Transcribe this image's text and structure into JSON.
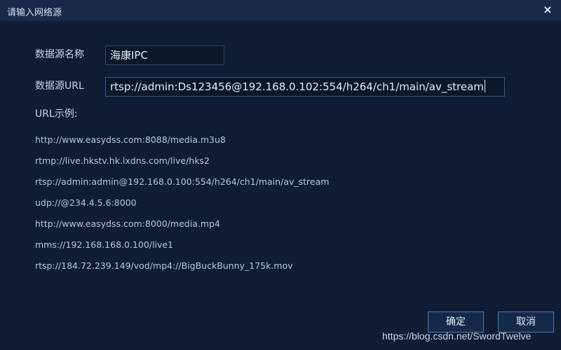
{
  "dialog": {
    "title": "请输入网络源",
    "close_label": "×"
  },
  "form": {
    "name_label": "数据源名称",
    "name_value": "海康IPC",
    "url_label": "数据源URL",
    "url_value": "rtsp://admin:Ds123456@192.168.0.102:554/h264/ch1/main/av_stream"
  },
  "examples": {
    "label": "URL示例:",
    "items": [
      "http://www.easydss.com:8088/media.m3u8",
      "rtmp://live.hkstv.hk.lxdns.com/live/hks2",
      "rtsp://admin:admin@192.168.0.100:554/h264/ch1/main/av_stream",
      "udp://@234.4.5.6:8000",
      "http://www.easydss.com:8000/media.mp4",
      "mms://192.168.168.0.100/live1",
      "rtsp://184.72.239.149/vod/mp4://BigBuckBunny_175k.mov"
    ]
  },
  "buttons": {
    "ok_label": "确定",
    "cancel_label": "取消"
  },
  "watermark": "https://blog.csdn.net/SwordTwelve"
}
